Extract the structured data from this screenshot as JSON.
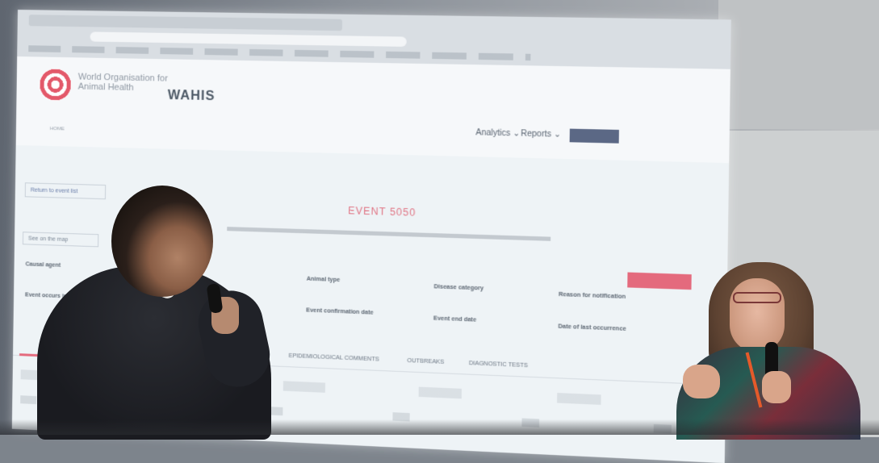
{
  "scene": {
    "description_colors": {
      "screen": "#eef3f6",
      "accent": "#e46a7d",
      "nav_button": "#5b6885"
    }
  },
  "site": {
    "org_name": "World Organisation for Animal Health",
    "app_name": "WAHIS",
    "nav_analytics": "Analytics ⌄",
    "nav_reports": "Reports ⌄",
    "breadcrumb": "HOME",
    "back_button": "Return to event list",
    "event_title": "EVENT 5050",
    "map_button": "See on the map",
    "tabs": [
      "EPIDEMIOLOGICAL COMMENTS",
      "OUTBREAKS",
      "DIAGNOSTIC TESTS"
    ],
    "fields": [
      {
        "label": "Causal agent"
      },
      {
        "label": "Event occurs in"
      },
      {
        "label": "Animal type"
      },
      {
        "label": "Event confirmation date"
      },
      {
        "label": "Disease category"
      },
      {
        "label": "Event end date"
      },
      {
        "label": "Reason for notification"
      },
      {
        "label": "Date of last occurrence"
      }
    ]
  }
}
